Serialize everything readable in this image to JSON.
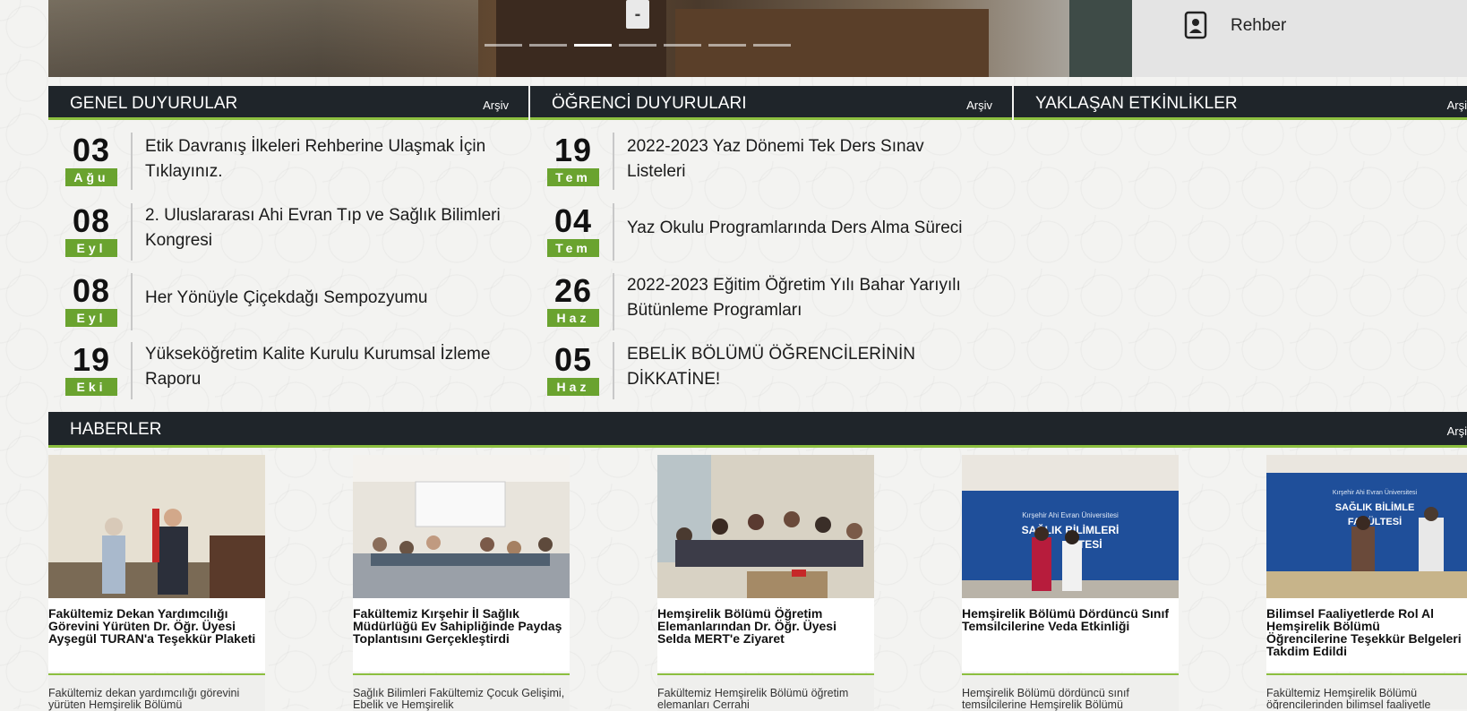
{
  "hero": {
    "control_label": "-",
    "slides_count": 7,
    "active_slide": 3
  },
  "guide": {
    "label": "Rehber",
    "icon": "contact-card-icon"
  },
  "sections": {
    "general": {
      "title": "GENEL DUYURULAR",
      "archive": "Arşiv"
    },
    "student": {
      "title": "ÖĞRENCİ DUYURULARI",
      "archive": "Arşiv"
    },
    "events": {
      "title": "YAKLAŞAN ETKİNLİKLER",
      "archive": "Arşi"
    },
    "news": {
      "title": "HABERLER",
      "archive": "Arşi"
    }
  },
  "general_announcements": [
    {
      "day": "03",
      "month": "Ağu",
      "text": "Etik Davranış İlkeleri Rehberine Ulaşmak İçin Tıklayınız."
    },
    {
      "day": "08",
      "month": "Eyl",
      "text": "2. Uluslararası Ahi Evran Tıp ve Sağlık Bilimleri Kongresi"
    },
    {
      "day": "08",
      "month": "Eyl",
      "text": "Her Yönüyle Çiçekdağı Sempozyumu"
    },
    {
      "day": "19",
      "month": "Eki",
      "text": "Yükseköğretim Kalite Kurulu Kurumsal İzleme Raporu"
    }
  ],
  "student_announcements": [
    {
      "day": "19",
      "month": "Tem",
      "text": "2022-2023 Yaz Dönemi Tek Ders Sınav Listeleri"
    },
    {
      "day": "04",
      "month": "Tem",
      "text": "Yaz Okulu Programlarında Ders Alma Süreci"
    },
    {
      "day": "26",
      "month": "Haz",
      "text": "2022-2023 Eğitim Öğretim Yılı Bahar Yarıyılı Bütünleme Programları"
    },
    {
      "day": "05",
      "month": "Haz",
      "text": "EBELİK BÖLÜMÜ ÖĞRENCİLERİNİN DİKKATİNE!"
    }
  ],
  "news_items": [
    {
      "title": "Fakültemiz Dekan Yardımcılığı Görevini Yürüten Dr. Öğr. Üyesi Ayşegül TURAN'a Teşekkür Plaketi",
      "summary": "Fakültemiz dekan yardımcılığı görevini yürüten Hemşirelik Bölümü"
    },
    {
      "title": "Fakültemiz Kırşehir İl Sağlık Müdürlüğü Ev Sahipliğinde Paydaş Toplantısını Gerçekleştirdi",
      "summary": "Sağlık Bilimleri Fakültemiz Çocuk Gelişimi, Ebelik ve Hemşirelik"
    },
    {
      "title": "Hemşirelik Bölümü Öğretim Elemanlarından Dr. Öğr. Üyesi Selda MERT'e Ziyaret",
      "summary": "Fakültemiz Hemşirelik Bölümü öğretim elemanları Cerrahi"
    },
    {
      "title": "Hemşirelik Bölümü Dördüncü Sınıf Temsilcilerine Veda Etkinliği",
      "summary": "Hemşirelik Bölümü dördüncü sınıf temsilcilerine Hemşirelik Bölümü",
      "banner_line1": "Kırşehir Ahi Evran Üniversitesi",
      "banner_line2": "SAĞLIK BİLİMLERİ",
      "banner_line3": "LTESİ"
    },
    {
      "title": "Bilimsel Faaliyetlerde Rol Al Hemşirelik Bölümü Öğrencilerine Teşekkür Belgeleri Takdim Edildi",
      "summary": "Fakültemiz Hemşirelik Bölümü öğrencilerinden bilimsel faaliyetle",
      "banner_line1": "Kırşehir Ahi Evran Üniversitesi",
      "banner_line2": "SAĞLIK BİLİMLE",
      "banner_line3": "FAKÜLTESİ"
    }
  ]
}
